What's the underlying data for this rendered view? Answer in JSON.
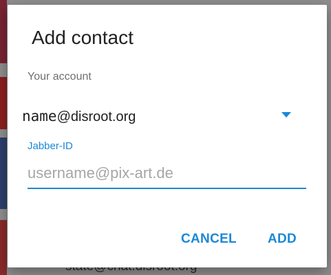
{
  "background": {
    "row_text": "state@chat.disroot.org"
  },
  "dialog": {
    "title": "Add contact",
    "account_label": "Your account",
    "account": {
      "name": "name",
      "domain": "@disroot.org"
    },
    "jid_label": "Jabber-ID",
    "jid_value": "",
    "jid_placeholder": "username@pix-art.de",
    "cancel_label": "CANCEL",
    "add_label": "ADD"
  },
  "colors": {
    "accent": "#1a88d6",
    "scrim": "#8f8f8f",
    "title_text": "#212121",
    "secondary_text": "#6f6f6f"
  },
  "icons": {
    "dropdown": "chevron-down-icon"
  }
}
